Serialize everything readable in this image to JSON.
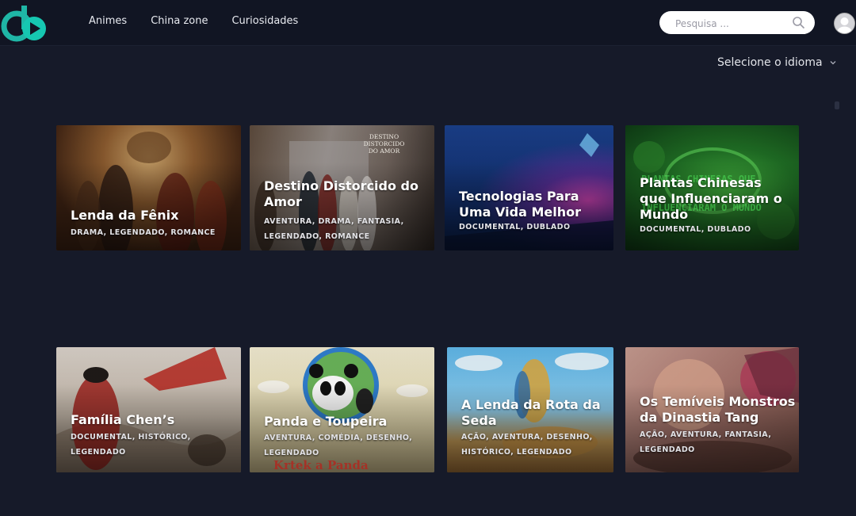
{
  "header": {
    "nav": [
      "Animes",
      "China zone",
      "Curiosidades"
    ],
    "search_placeholder": "Pesquisa ..."
  },
  "language_selector": {
    "label": "Selecione o idioma"
  },
  "cards": [
    {
      "title": "Lenda da Fênix",
      "tags": "DRAMA, LEGENDADO, ROMANCE",
      "poster_text": ""
    },
    {
      "title": "Destino Distorcido do Amor",
      "tags": "AVENTURA, DRAMA, FANTASIA, LEGENDADO, ROMANCE",
      "poster_text": "DESTINO DISTORCIDO DO AMOR"
    },
    {
      "title": "Tecnologias Para Uma Vida Melhor",
      "tags": "DOCUMENTAL, DUBLADO",
      "poster_text": ""
    },
    {
      "title": "Plantas Chinesas que Influenciaram o Mundo",
      "tags": "DOCUMENTAL, DUBLADO",
      "poster_text": "PLANTAS CHINESAS QUE INFLUENCIARAM O MUNDO"
    },
    {
      "title": "Família Chen’s",
      "tags": "DOCUMENTAL, HISTÓRICO, LEGENDADO",
      "poster_text": ""
    },
    {
      "title": "Panda e Toupeira",
      "tags": "AVENTURA, COMÉDIA, DESENHO, LEGENDADO",
      "poster_text": "Krtek a Panda"
    },
    {
      "title": "A Lenda da Rota da Seda",
      "tags": "AÇÃO, AVENTURA, DESENHO, HISTÓRICO, LEGENDADO",
      "poster_text": ""
    },
    {
      "title": "Os Temíveis Monstros da Dinastia Tang",
      "tags": "AÇÃO, AVENTURA, FANTASIA, LEGENDADO",
      "poster_text": ""
    }
  ]
}
